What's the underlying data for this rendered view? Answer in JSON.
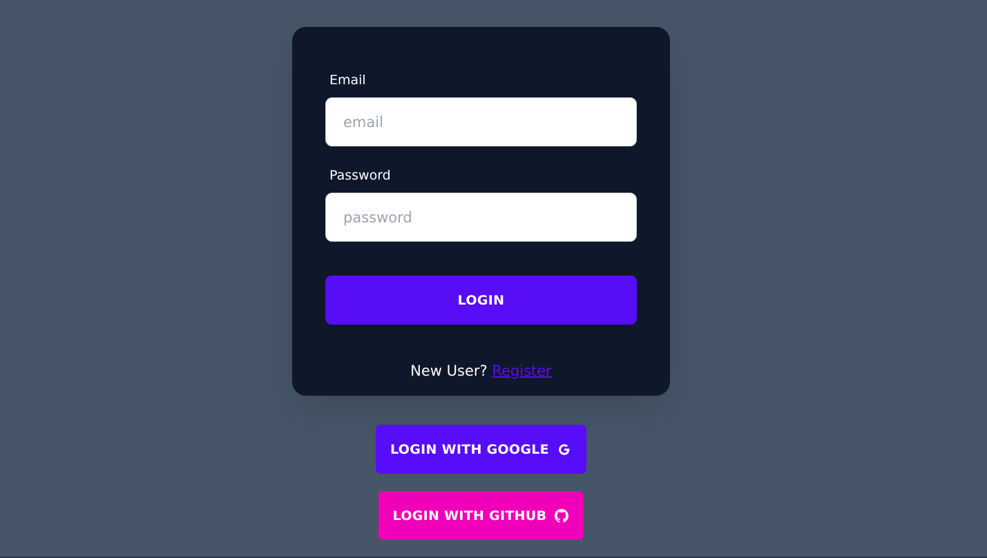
{
  "form": {
    "email_label": "Email",
    "email_placeholder": "email",
    "email_value": "",
    "password_label": "Password",
    "password_placeholder": "password",
    "password_value": "",
    "login_button": "LOGIN",
    "new_user_text": "New User? ",
    "register_link": "Register"
  },
  "social": {
    "google_button": "LOGIN WITH GOOGLE",
    "google_icon": "google-icon",
    "github_button": "LOGIN WITH GITHUB",
    "github_icon": "github-icon"
  },
  "colors": {
    "page_background": "#475569",
    "card_background": "#0f172a",
    "primary": "#570df8",
    "secondary": "#f000b8"
  }
}
